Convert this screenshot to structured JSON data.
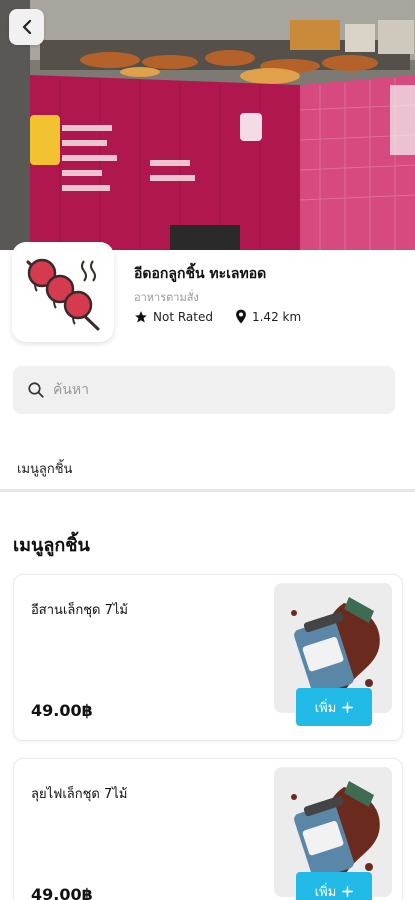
{
  "header": {
    "back_icon": "chevron-left-icon"
  },
  "shop": {
    "name": "อีดอกลูกชิ้น ทะเลทอด",
    "category": "อาหารตามสั่ง",
    "rating_text": "Not Rated",
    "distance_text": "1.42 km",
    "logo_icon": "meatball-skewer-icon"
  },
  "search": {
    "placeholder": "ค้นหา"
  },
  "category_tabs": [
    {
      "label": "เมนูลูกชิ้น"
    }
  ],
  "section": {
    "title": "เมนูลูกชิ้น"
  },
  "menu_items": [
    {
      "name": "อีสานเล็กชุด 7ไม้",
      "price": "49.00฿",
      "add_label": "เพิ่ม"
    },
    {
      "name": "ลุยไฟเล็กชุด 7ไม้",
      "price": "49.00฿",
      "add_label": "เพิ่ม"
    }
  ],
  "colors": {
    "accent": "#21b9e5",
    "banner_pink": "#c2185b"
  }
}
